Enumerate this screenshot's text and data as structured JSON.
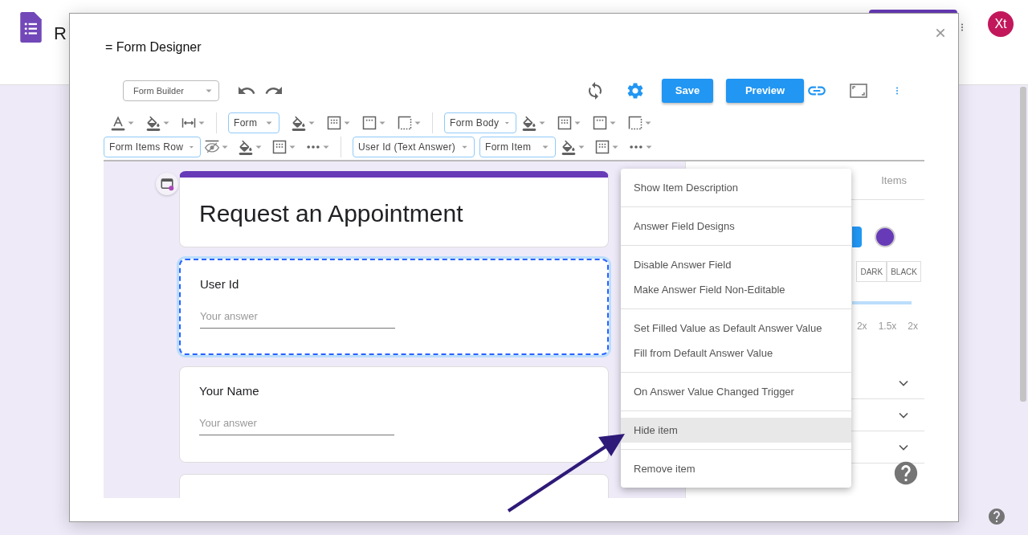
{
  "app_header": {
    "title": "R",
    "avatar": "Xt"
  },
  "dialog": {
    "title": "= Form Designer",
    "toolbar": {
      "mode_select": "Form Builder",
      "buttons": [
        "Save",
        "Preview"
      ]
    },
    "style_selects": [
      "Form",
      "Form Body",
      "Form Items Row",
      "User Id (Text Answer)",
      "Form Item"
    ],
    "form": {
      "title": "Request an Appointment",
      "questions": [
        {
          "label": "User Id",
          "placeholder": "Your answer",
          "selected": true
        },
        {
          "label": "Your Name",
          "placeholder": "Your answer",
          "selected": false
        }
      ]
    },
    "context_menu": {
      "groups": [
        [
          {
            "label": "Show Item Description",
            "selected": false
          }
        ],
        [
          {
            "label": "Answer Field Designs",
            "selected": false
          }
        ],
        [
          {
            "label": "Disable Answer Field",
            "selected": false
          },
          {
            "label": "Make Answer Field Non-Editable",
            "selected": false
          }
        ],
        [
          {
            "label": "Set Filled Value as Default Answer Value",
            "selected": false
          },
          {
            "label": "Fill from Default Answer Value",
            "selected": false
          }
        ],
        [
          {
            "label": "On Answer Value Changed Trigger",
            "selected": false
          }
        ],
        [
          {
            "label": "Hide item",
            "selected": true
          }
        ],
        [
          {
            "label": "Remove item",
            "selected": false
          }
        ]
      ]
    },
    "side_panel": {
      "tab": "Items",
      "theme_buttons": [
        "DARK",
        "BLACK"
      ],
      "scale_labels": [
        "2x",
        "1.5x",
        "2x"
      ]
    }
  }
}
